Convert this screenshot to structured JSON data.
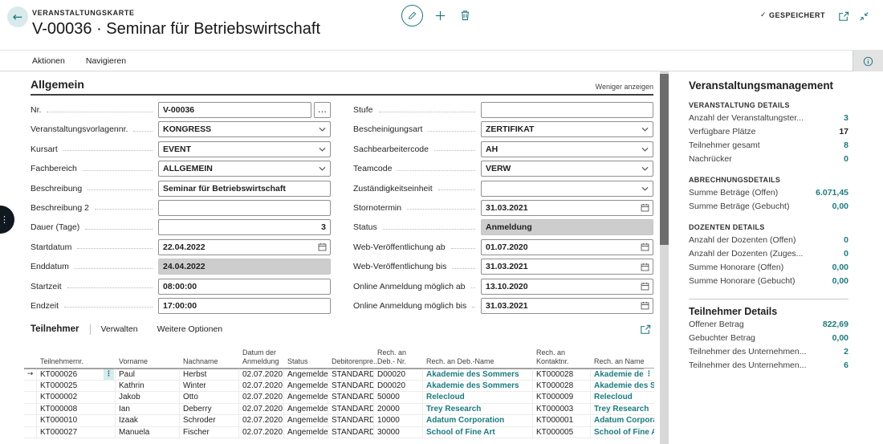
{
  "header": {
    "caption": "VERANSTALTUNGSKARTE",
    "title": "V-00036 · Seminar für Betriebswirtschaft",
    "saved_label": "GESPEICHERT"
  },
  "ribbon": {
    "items": [
      "Aktionen",
      "Navigieren"
    ]
  },
  "general": {
    "section_title": "Allgemein",
    "show_less": "Weniger anzeigen",
    "left": [
      {
        "label": "Nr.",
        "value": "V-00036"
      },
      {
        "label": "Veranstaltungsvorlagennr.",
        "value": "KONGRESS"
      },
      {
        "label": "Kursart",
        "value": "EVENT"
      },
      {
        "label": "Fachbereich",
        "value": "ALLGEMEIN"
      },
      {
        "label": "Beschreibung",
        "value": "Seminar für Betriebswirtschaft"
      },
      {
        "label": "Beschreibung 2",
        "value": ""
      },
      {
        "label": "Dauer (Tage)",
        "value": "3"
      },
      {
        "label": "Startdatum",
        "value": "22.04.2022"
      },
      {
        "label": "Enddatum",
        "value": "24.04.2022"
      },
      {
        "label": "Startzeit",
        "value": "08:00:00"
      },
      {
        "label": "Endzeit",
        "value": "17:00:00"
      }
    ],
    "right": [
      {
        "label": "Stufe",
        "value": ""
      },
      {
        "label": "Bescheinigungsart",
        "value": "ZERTIFIKAT"
      },
      {
        "label": "Sachbearbeitercode",
        "value": "AH"
      },
      {
        "label": "Teamcode",
        "value": "VERW"
      },
      {
        "label": "Zuständigkeitseinheit",
        "value": ""
      },
      {
        "label": "Stornotermin",
        "value": "31.03.2021"
      },
      {
        "label": "Status",
        "value": "Anmeldung"
      },
      {
        "label": "Web-Veröffentlichung ab",
        "value": "01.07.2020"
      },
      {
        "label": "Web-Veröffentlichung bis",
        "value": "31.03.2021"
      },
      {
        "label": "Online Anmeldung möglich ab",
        "value": "13.10.2020"
      },
      {
        "label": "Online Anmeldung möglich bis",
        "value": "31.03.2021"
      }
    ]
  },
  "part": {
    "title": "Teilnehmer",
    "menu": [
      "Verwalten",
      "Weitere Optionen"
    ]
  },
  "table": {
    "columns": [
      "Teilnehmernr.",
      "Vorname",
      "Nachname",
      "Datum der Anmeldung",
      "Status",
      "Debitorenpre...",
      "Rech. an Deb.- Nr.",
      "Rech. an Deb.-Name",
      "Rech. an Kontaktnr.",
      "Rech. an Name"
    ],
    "rows": [
      {
        "nr": "KT000026",
        "vorname": "Paul",
        "nachname": "Herbst",
        "datum": "02.07.2020",
        "status": "Angemeldet",
        "preisgruppe": "STANDARD",
        "deb_nr": "D00020",
        "deb_name": "Akademie des Sommers",
        "kontaktnr": "KT000028",
        "name": "Akademie des Somme"
      },
      {
        "nr": "KT000025",
        "vorname": "Kathrin",
        "nachname": "Winter",
        "datum": "02.07.2020",
        "status": "Angemeldet",
        "preisgruppe": "STANDARD",
        "deb_nr": "D00020",
        "deb_name": "Akademie des Sommers",
        "kontaktnr": "KT000028",
        "name": "Akademie des Somme"
      },
      {
        "nr": "KT000002",
        "vorname": "Jakob",
        "nachname": "Otto",
        "datum": "02.07.2020",
        "status": "Angemeldet",
        "preisgruppe": "STANDARD",
        "deb_nr": "50000",
        "deb_name": "Relecloud",
        "kontaktnr": "KT000009",
        "name": "Relecloud"
      },
      {
        "nr": "KT000008",
        "vorname": "Ian",
        "nachname": "Deberry",
        "datum": "02.07.2020",
        "status": "Angemeldet",
        "preisgruppe": "STANDARD",
        "deb_nr": "20000",
        "deb_name": "Trey Research",
        "kontaktnr": "KT000003",
        "name": "Trey Research"
      },
      {
        "nr": "KT000010",
        "vorname": "Izaak",
        "nachname": "Schroder",
        "datum": "02.07.2020",
        "status": "Angemeldet",
        "preisgruppe": "STANDARD",
        "deb_nr": "10000",
        "deb_name": "Adatum Corporation",
        "kontaktnr": "KT000001",
        "name": "Adatum Corporation"
      },
      {
        "nr": "KT000027",
        "vorname": "Manuela",
        "nachname": "Fischer",
        "datum": "02.07.2020",
        "status": "Angemeldet",
        "preisgruppe": "STANDARD",
        "deb_nr": "30000",
        "deb_name": "School of Fine Art",
        "kontaktnr": "KT000005",
        "name": "School of Fine Art"
      }
    ]
  },
  "sidebar": {
    "title": "Veranstaltungsmanagement",
    "groups": [
      {
        "caption": "VERANSTALTUNG DETAILS",
        "rows": [
          {
            "label": "Anzahl der Veranstaltungster...",
            "value": "3"
          },
          {
            "label": "Verfügbare Plätze",
            "value": "17"
          },
          {
            "label": "Teilnehmer gesamt",
            "value": "8"
          },
          {
            "label": "Nachrücker",
            "value": "0"
          }
        ]
      },
      {
        "caption": "ABRECHNUNGSDETAILS",
        "rows": [
          {
            "label": "Summe Beträge (Offen)",
            "value": "6.071,45"
          },
          {
            "label": "Summe Beträge (Gebucht)",
            "value": "0,00"
          }
        ]
      },
      {
        "caption": "DOZENTEN DETAILS",
        "rows": [
          {
            "label": "Anzahl der Dozenten (Offen)",
            "value": "0"
          },
          {
            "label": "Anzahl der Dozenten (Zuges...",
            "value": "0"
          },
          {
            "label": "Summe Honorare (Offen)",
            "value": "0,00"
          },
          {
            "label": "Summe Honorare (Gebucht)",
            "value": "0,00"
          }
        ]
      }
    ],
    "details": {
      "heading": "Teilnehmer Details",
      "rows": [
        {
          "label": "Offener Betrag",
          "value": "822,69"
        },
        {
          "label": "Gebuchter Betrag",
          "value": "0,00"
        },
        {
          "label": "Teilnehmer des Unternehmen...",
          "value": "2"
        },
        {
          "label": "Teilnehmer des Unternehmen...",
          "value": "6"
        }
      ]
    }
  },
  "icons": {
    "ellipsis": "…",
    "vertical_ellipsis": "⋮",
    "row_pointer": "→",
    "check": "✓",
    "back_arrow": "←"
  },
  "colors": {
    "accent": "#17757d",
    "link": "#1a7b80",
    "disabled_bg": "#cdcdcd"
  }
}
